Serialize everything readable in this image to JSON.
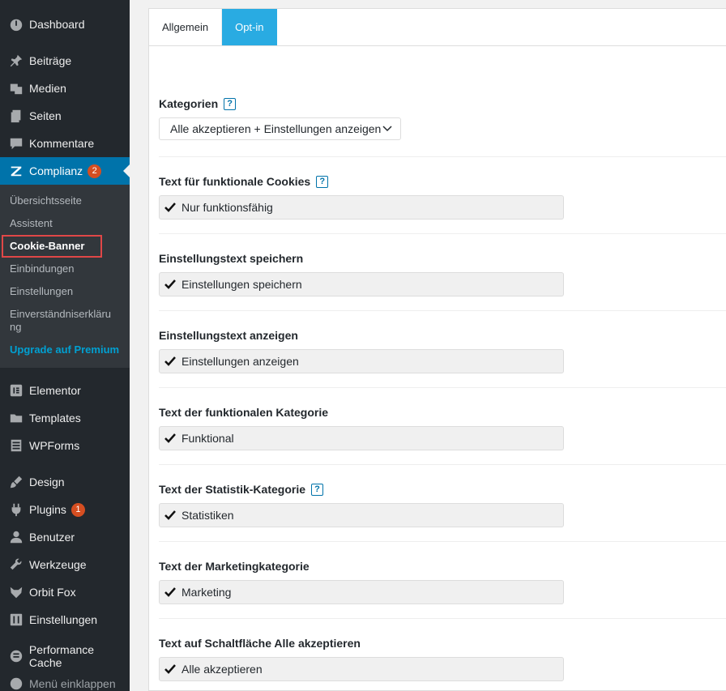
{
  "sidebar": {
    "dashboard": "Dashboard",
    "beitraege": "Beiträge",
    "medien": "Medien",
    "seiten": "Seiten",
    "kommentare": "Kommentare",
    "complianz": "Complianz",
    "complianz_badge": "2",
    "submenu": [
      "Übersichtsseite",
      "Assistent",
      "Cookie-Banner",
      "Einbindungen",
      "Einstellungen",
      "Einverständniserklärung",
      "Upgrade auf Premium"
    ],
    "elementor": "Elementor",
    "templates": "Templates",
    "wpforms": "WPForms",
    "design": "Design",
    "plugins": "Plugins",
    "plugins_badge": "1",
    "benutzer": "Benutzer",
    "werkzeuge": "Werkzeuge",
    "orbitfox": "Orbit Fox",
    "einstellungen": "Einstellungen",
    "performance": "Performance Cache",
    "collapse": "Menü einklappen"
  },
  "tabs": [
    "Allgemein",
    "Opt-in"
  ],
  "fields": {
    "kategorien": {
      "label": "Kategorien",
      "value": "Alle akzeptieren + Einstellungen anzeigen"
    },
    "funktional_cookies": {
      "label": "Text für funktionale Cookies",
      "value": "Nur funktionsfähig"
    },
    "speichern": {
      "label": "Einstellungstext speichern",
      "value": "Einstellungen speichern"
    },
    "anzeigen": {
      "label": "Einstellungstext anzeigen",
      "value": "Einstellungen anzeigen"
    },
    "funktional_kat": {
      "label": "Text der funktionalen Kategorie",
      "value": "Funktional"
    },
    "statistik": {
      "label": "Text der Statistik-Kategorie",
      "value": "Statistiken"
    },
    "marketing": {
      "label": "Text der Marketingkategorie",
      "value": "Marketing"
    },
    "alle": {
      "label": "Text auf Schaltfläche Alle akzeptieren",
      "value": "Alle akzeptieren"
    }
  },
  "help_glyph": "?",
  "colors": {
    "sidebar_bg": "#23282d",
    "active": "#0073aa",
    "tab_active": "#29abe2",
    "badge": "#d54e21",
    "highlight": "#e04747"
  }
}
